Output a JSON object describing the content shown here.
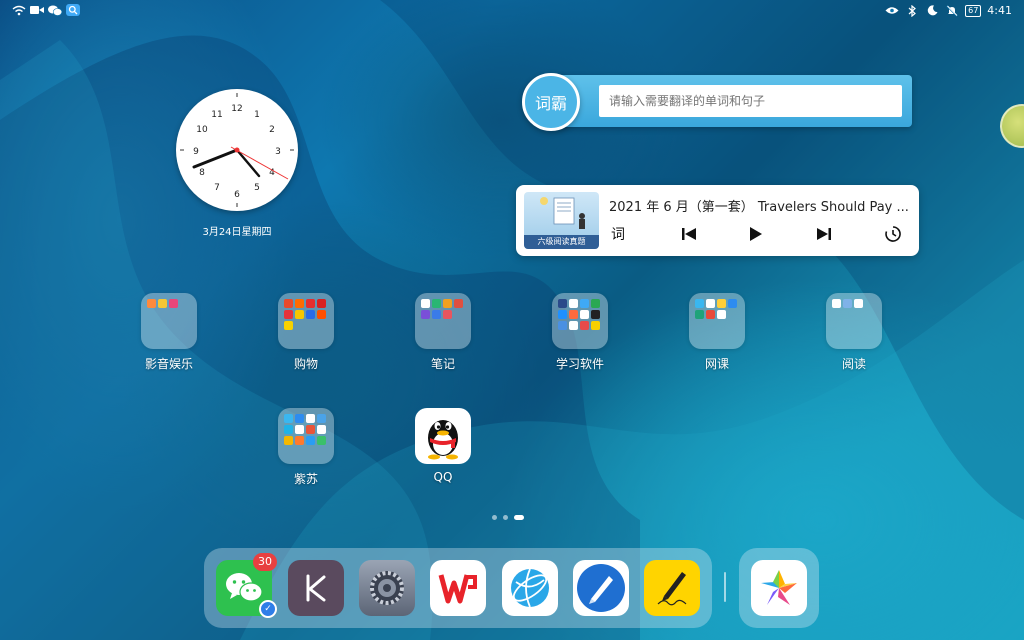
{
  "status_bar": {
    "left_icons": [
      "wifi-icon",
      "video-icon",
      "wechat-icon",
      "search-app-icon"
    ],
    "right_icons": [
      "eye-icon",
      "bluetooth-icon",
      "moon-icon",
      "bell-off-icon"
    ],
    "battery": "67",
    "time": "4:41"
  },
  "clock_widget": {
    "numbers": [
      "12",
      "1",
      "2",
      "3",
      "4",
      "5",
      "6",
      "7",
      "8",
      "9",
      "10",
      "11"
    ],
    "date": "3月24日星期四"
  },
  "translator_widget": {
    "logo": "词霸",
    "placeholder": "请输入需要翻译的单词和句子"
  },
  "player_widget": {
    "cover_caption": "六级阅读真题",
    "title": "2021 年 6 月（第一套） Travelers Should Pay ...",
    "word_label": "词"
  },
  "apps": [
    {
      "label": "影音娱乐"
    },
    {
      "label": "购物"
    },
    {
      "label": "笔记"
    },
    {
      "label": "学习软件"
    },
    {
      "label": "网课"
    },
    {
      "label": "阅读"
    },
    {
      "label": "紫苏"
    },
    {
      "label": "QQ"
    }
  ],
  "dock": {
    "wechat_badge": "30",
    "apps": [
      "wechat-icon",
      "k-app-icon",
      "settings-icon",
      "wps-icon",
      "browser-icon",
      "pen-notes-icon",
      "sign-notes-icon"
    ],
    "recent_app": "gallery-icon"
  },
  "colors": {
    "wallpaper_dark": "#0b4f86",
    "wallpaper_light": "#18a3c2",
    "badge": "#e84040",
    "translator": "#3aa7dc"
  }
}
